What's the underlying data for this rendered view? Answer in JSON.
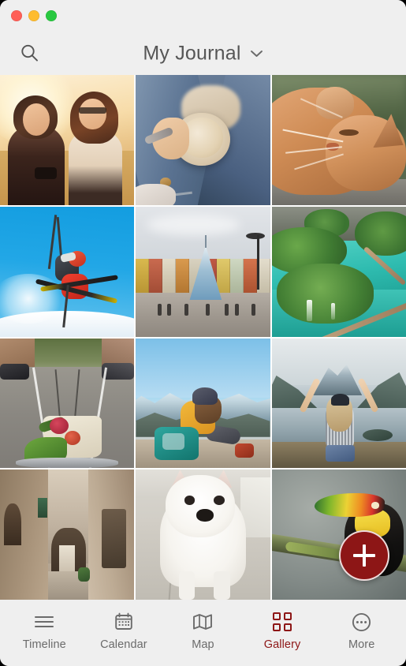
{
  "window": {
    "traffic_lights": [
      {
        "name": "close",
        "color": "#ff5f57"
      },
      {
        "name": "minimize",
        "color": "#febc2e"
      },
      {
        "name": "zoom",
        "color": "#28c840"
      }
    ]
  },
  "header": {
    "title": "My Journal",
    "search_icon": "search-icon",
    "chevron_icon": "chevron-down-icon"
  },
  "gallery": {
    "photos": [
      {
        "id": 1,
        "caption": "Two women laughing in a golden field at sunset"
      },
      {
        "id": 2,
        "caption": "Hand holding a latte cup over blue jeans"
      },
      {
        "id": 3,
        "caption": "Ginger long-haired cat resting on stone"
      },
      {
        "id": 4,
        "caption": "Skier mid-jump against a blue sky"
      },
      {
        "id": 5,
        "caption": "Old town square with colorful houses and Christmas tree"
      },
      {
        "id": 6,
        "caption": "Turquoise lakes with wooden boardwalks and waterfalls"
      },
      {
        "id": 7,
        "caption": "Bicycle basket with groceries on a tram street"
      },
      {
        "id": 8,
        "caption": "Woman in yellow jacket writing on a mountain summit"
      },
      {
        "id": 9,
        "caption": "Woman with arms raised above a mountain lake"
      },
      {
        "id": 10,
        "caption": "Narrow stone alley in a Mediterranean old town"
      },
      {
        "id": 11,
        "caption": "White Samoyed puppy standing indoors"
      },
      {
        "id": 12,
        "caption": "Keel-billed toucan perched on a mossy branch"
      }
    ]
  },
  "fab": {
    "label": "+",
    "icon": "plus-icon",
    "color": "#8d1616"
  },
  "tabbar": {
    "accent_color": "#8d1616",
    "inactive_color": "#6b6b6b",
    "items": [
      {
        "label": "Timeline",
        "icon": "list-icon",
        "active": false
      },
      {
        "label": "Calendar",
        "icon": "calendar-icon",
        "active": false
      },
      {
        "label": "Map",
        "icon": "map-icon",
        "active": false
      },
      {
        "label": "Gallery",
        "icon": "grid-icon",
        "active": true
      },
      {
        "label": "More",
        "icon": "ellipsis-circle-icon",
        "active": false
      }
    ]
  }
}
